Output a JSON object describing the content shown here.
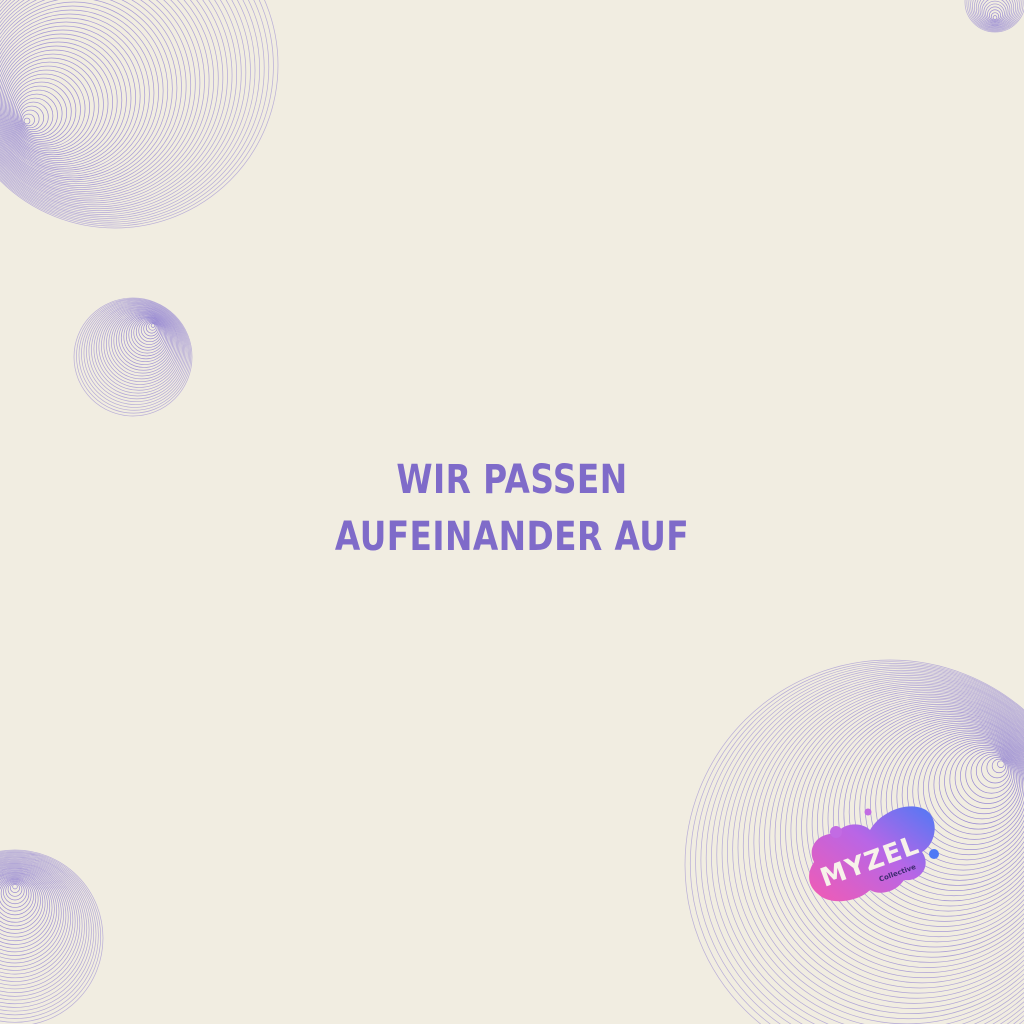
{
  "colors": {
    "background": "#f1ede1",
    "accent": "#7f6bc9",
    "line": "#8a7ad0",
    "logo_pink": "#f25bb3",
    "logo_blue": "#4f79f5"
  },
  "headline": {
    "line1": "WIR PASSEN",
    "line2": "AUFEINANDER AUF"
  },
  "logo": {
    "wordmark": "MYZEL",
    "subtitle": "Collective"
  },
  "decorations": [
    "striped-sphere",
    "striped-sphere",
    "striped-sphere",
    "striped-sphere",
    "striped-sphere"
  ]
}
